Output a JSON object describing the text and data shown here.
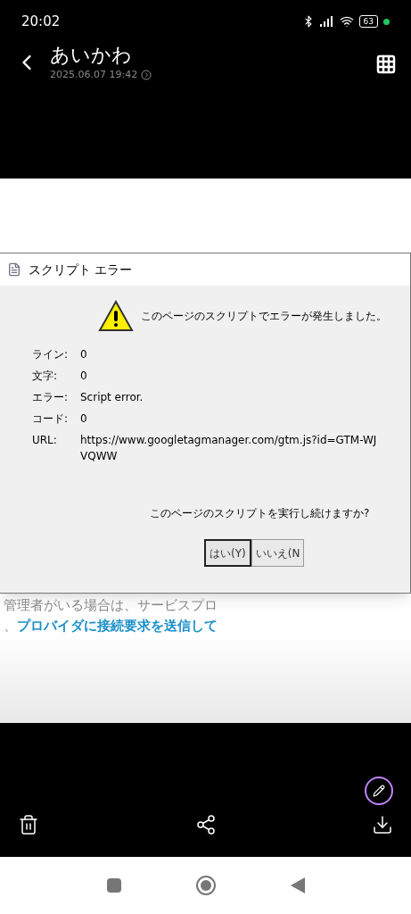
{
  "status_bar": {
    "time": "20:02",
    "battery": "63"
  },
  "header": {
    "title": "あいかわ",
    "subtitle": "2025.06.07 19:42"
  },
  "photo": {
    "dialog": {
      "title": "スクリプト エラー",
      "message": "このページのスクリプトでエラーが発生しました。",
      "fields": [
        {
          "label": "ライン:",
          "value": "0"
        },
        {
          "label": "文字:",
          "value": "0"
        },
        {
          "label": "エラー:",
          "value": "Script error."
        },
        {
          "label": "コード:",
          "value": "0"
        },
        {
          "label": "URL:",
          "value": "https://www.googletagmanager.com/gtm.js?id=GTM-WJVQWW"
        }
      ],
      "question": "このページのスクリプトを実行し続けますか?",
      "buttons": [
        {
          "label": "はい(Y)",
          "selected": true
        },
        {
          "label": "いいえ(N",
          "selected": false
        }
      ]
    },
    "background_lines": [
      {
        "kind": "plain",
        "text": "管理者がいる場合は、サービスプロ"
      },
      {
        "kind": "link",
        "prefix": "、",
        "text": "プロバイダに接続要求を送信して"
      }
    ]
  }
}
